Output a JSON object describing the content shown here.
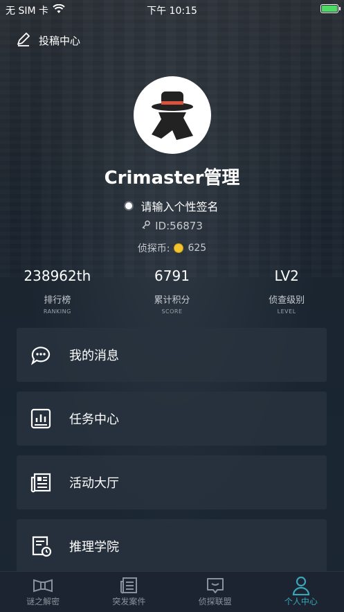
{
  "status_bar": {
    "carrier": "无 SIM 卡",
    "time": "下午 10:15"
  },
  "header": {
    "submit_label": "投稿中心"
  },
  "profile": {
    "username": "Crimaster管理",
    "signature": "请输入个性签名",
    "id_text": "ID:56873",
    "coins_label": "侦探币:",
    "coins_value": "625"
  },
  "stats": [
    {
      "value": "238962th",
      "label": "排行榜",
      "sub": "RANKING"
    },
    {
      "value": "6791",
      "label": "累计积分",
      "sub": "SCORE"
    },
    {
      "value": "LV2",
      "label": "侦查级别",
      "sub": "LEVEL"
    }
  ],
  "menu": [
    {
      "label": "我的消息",
      "icon": "chat-bubbles-icon"
    },
    {
      "label": "任务中心",
      "icon": "bar-chart-icon"
    },
    {
      "label": "活动大厅",
      "icon": "newspaper-icon"
    },
    {
      "label": "推理学院",
      "icon": "document-clock-icon"
    }
  ],
  "tabs": [
    {
      "label": "谜之解密",
      "icon": "ribbon-icon"
    },
    {
      "label": "突发案件",
      "icon": "newspaper-icon"
    },
    {
      "label": "侦探联盟",
      "icon": "chat-icon"
    },
    {
      "label": "个人中心",
      "icon": "person-icon",
      "active": true
    }
  ],
  "colors": {
    "accent": "#3aa6b8",
    "coin": "#f4c430",
    "battery": "#4cd964"
  }
}
